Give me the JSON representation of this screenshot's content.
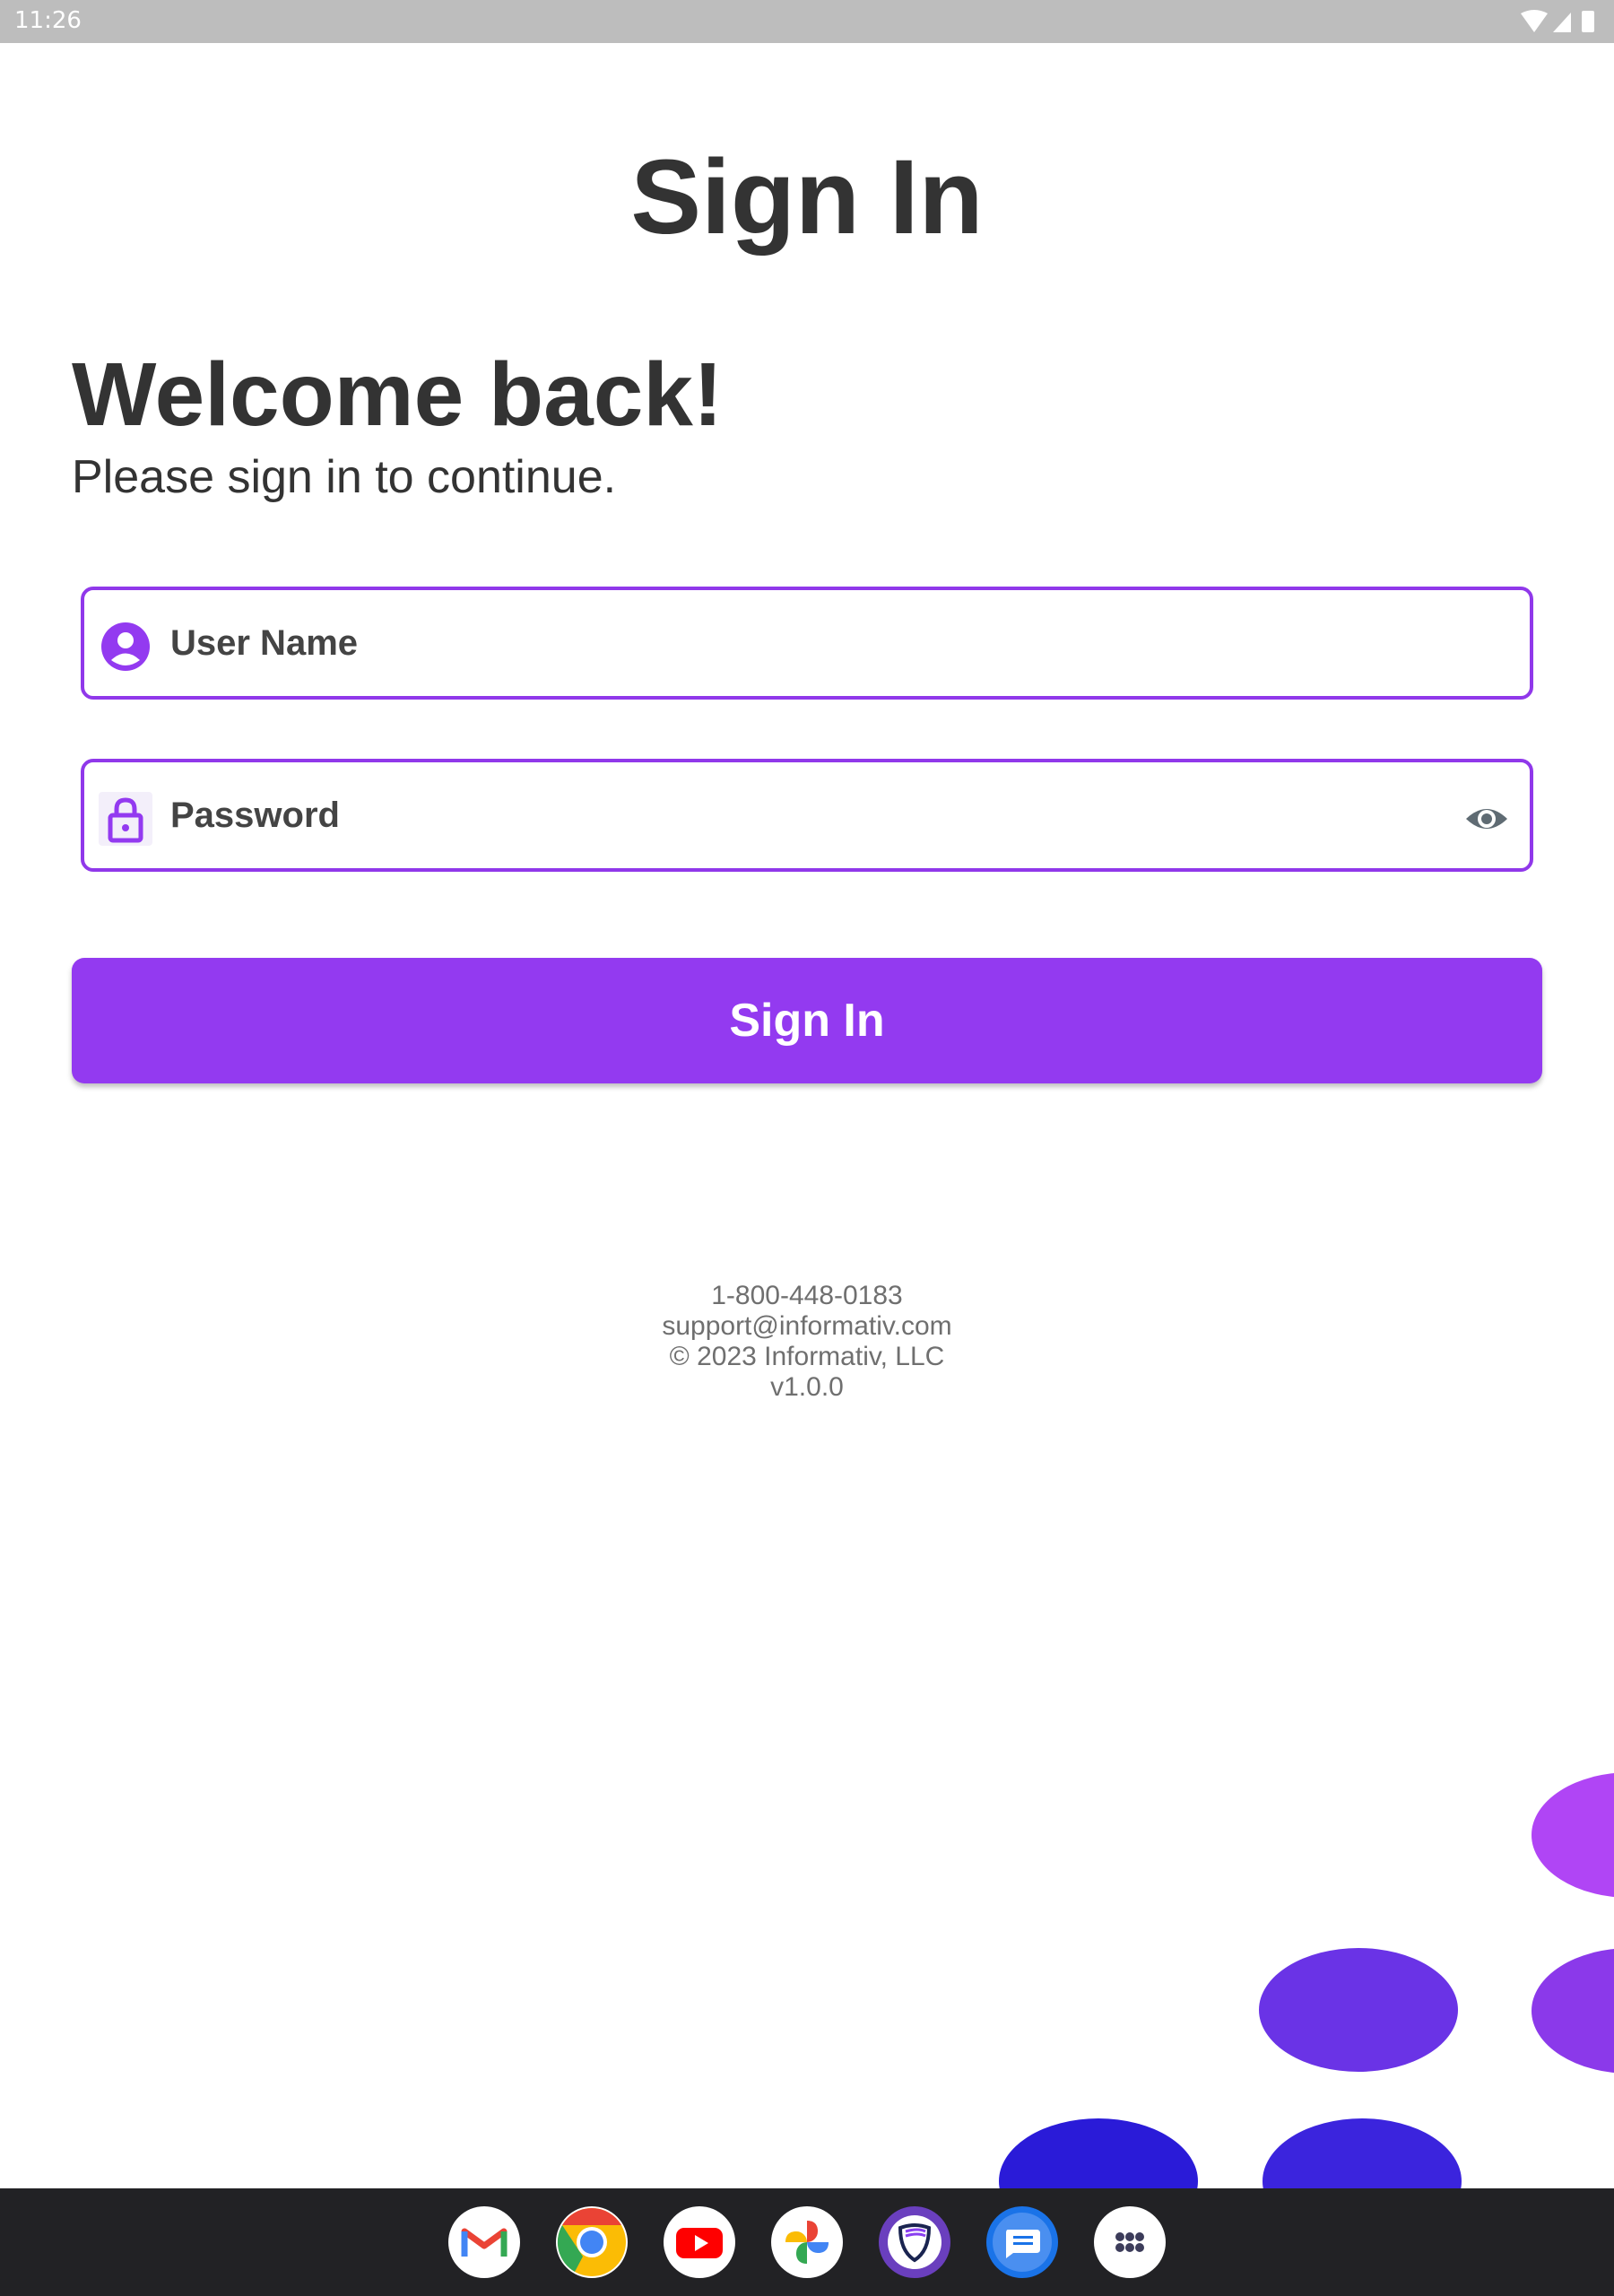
{
  "status_bar": {
    "time": "11:26",
    "icons": [
      "wifi-icon",
      "signal-icon",
      "battery-icon"
    ]
  },
  "page_title": "Sign In",
  "welcome": {
    "heading": "Welcome back!",
    "subheading": "Please sign in to continue."
  },
  "form": {
    "username": {
      "placeholder": "User Name",
      "icon": "user-icon"
    },
    "password": {
      "placeholder": "Password",
      "icon": "lock-icon",
      "toggle_icon": "eye-icon"
    },
    "submit_label": "Sign In"
  },
  "footer": {
    "phone": "1-800-448-0183",
    "email": "support@informativ.com",
    "copyright": "© 2023 Informativ, LLC",
    "version": "v1.0.0"
  },
  "dock": {
    "apps": [
      "gmail-icon",
      "chrome-icon",
      "youtube-icon",
      "photos-icon",
      "shield-app-icon",
      "messages-icon",
      "app-drawer-icon"
    ]
  },
  "colors": {
    "accent": "#933af0",
    "field_border": "#9038ea",
    "text_dark": "#333333",
    "text_muted": "#6f6f6f",
    "status_bar": "#bdbdbd",
    "dock": "#222225"
  }
}
